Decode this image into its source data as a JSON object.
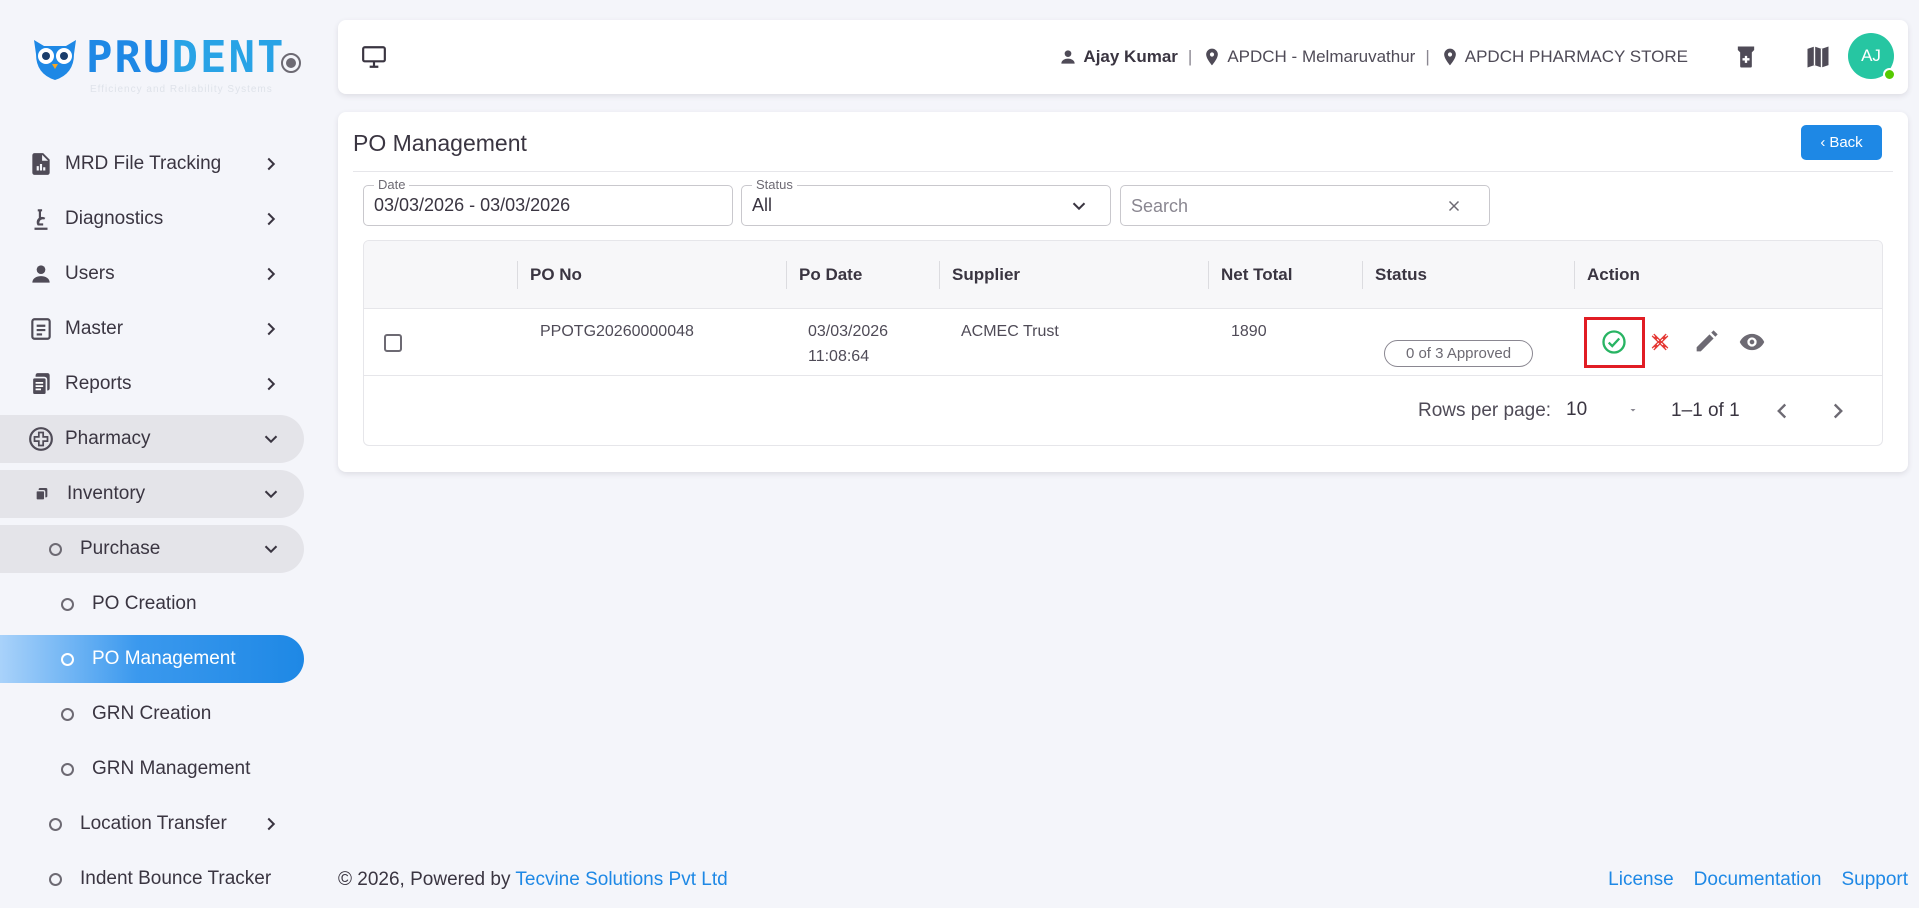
{
  "brand": {
    "name_part1": "PRU",
    "name_part2": "DENT",
    "tagline": "Efficiency and Reliability Systems"
  },
  "sidebar": {
    "items": [
      {
        "label": "MRD File Tracking"
      },
      {
        "label": "Diagnostics"
      },
      {
        "label": "Users"
      },
      {
        "label": "Master"
      },
      {
        "label": "Reports"
      },
      {
        "label": "Pharmacy"
      },
      {
        "label": "Inventory"
      },
      {
        "label": "Purchase"
      },
      {
        "label": "PO Creation"
      },
      {
        "label": "PO Management"
      },
      {
        "label": "GRN Creation"
      },
      {
        "label": "GRN Management"
      },
      {
        "label": "Location Transfer"
      },
      {
        "label": "Indent Bounce Tracker"
      }
    ]
  },
  "topbar": {
    "user_name": "Ajay Kumar",
    "location": "APDCH - Melmaruvathur",
    "store": "APDCH PHARMACY STORE",
    "avatar_initials": "AJ"
  },
  "page": {
    "title": "PO Management",
    "back_label": "Back",
    "filters": {
      "date_label": "Date",
      "date_value": "03/03/2026 - 03/03/2026",
      "status_label": "Status",
      "status_value": "All",
      "search_placeholder": "Search"
    },
    "table": {
      "columns": [
        "PO No",
        "Po Date",
        "Supplier",
        "Net Total",
        "Status",
        "Action"
      ],
      "rows": [
        {
          "po_no": "PPOTG20260000048",
          "po_date_line1": "03/03/2026",
          "po_date_line2": "11:08:64",
          "supplier": "ACMEC Trust",
          "net_total": "1890",
          "status": "0 of 3 Approved"
        }
      ]
    },
    "pagination": {
      "rows_per_page_label": "Rows per page:",
      "rows_per_page_value": "10",
      "range": "1–1 of 1"
    }
  },
  "footer": {
    "copyright": "© 2026, Powered by ",
    "company": "Tecvine Solutions Pvt Ltd",
    "links": [
      "License",
      "Documentation",
      "Support"
    ]
  },
  "colors": {
    "primary": "#1e88e5",
    "approve": "#28b463",
    "reject": "#e53935",
    "highlight": "#e11d24",
    "avatar": "#26c6a2"
  }
}
